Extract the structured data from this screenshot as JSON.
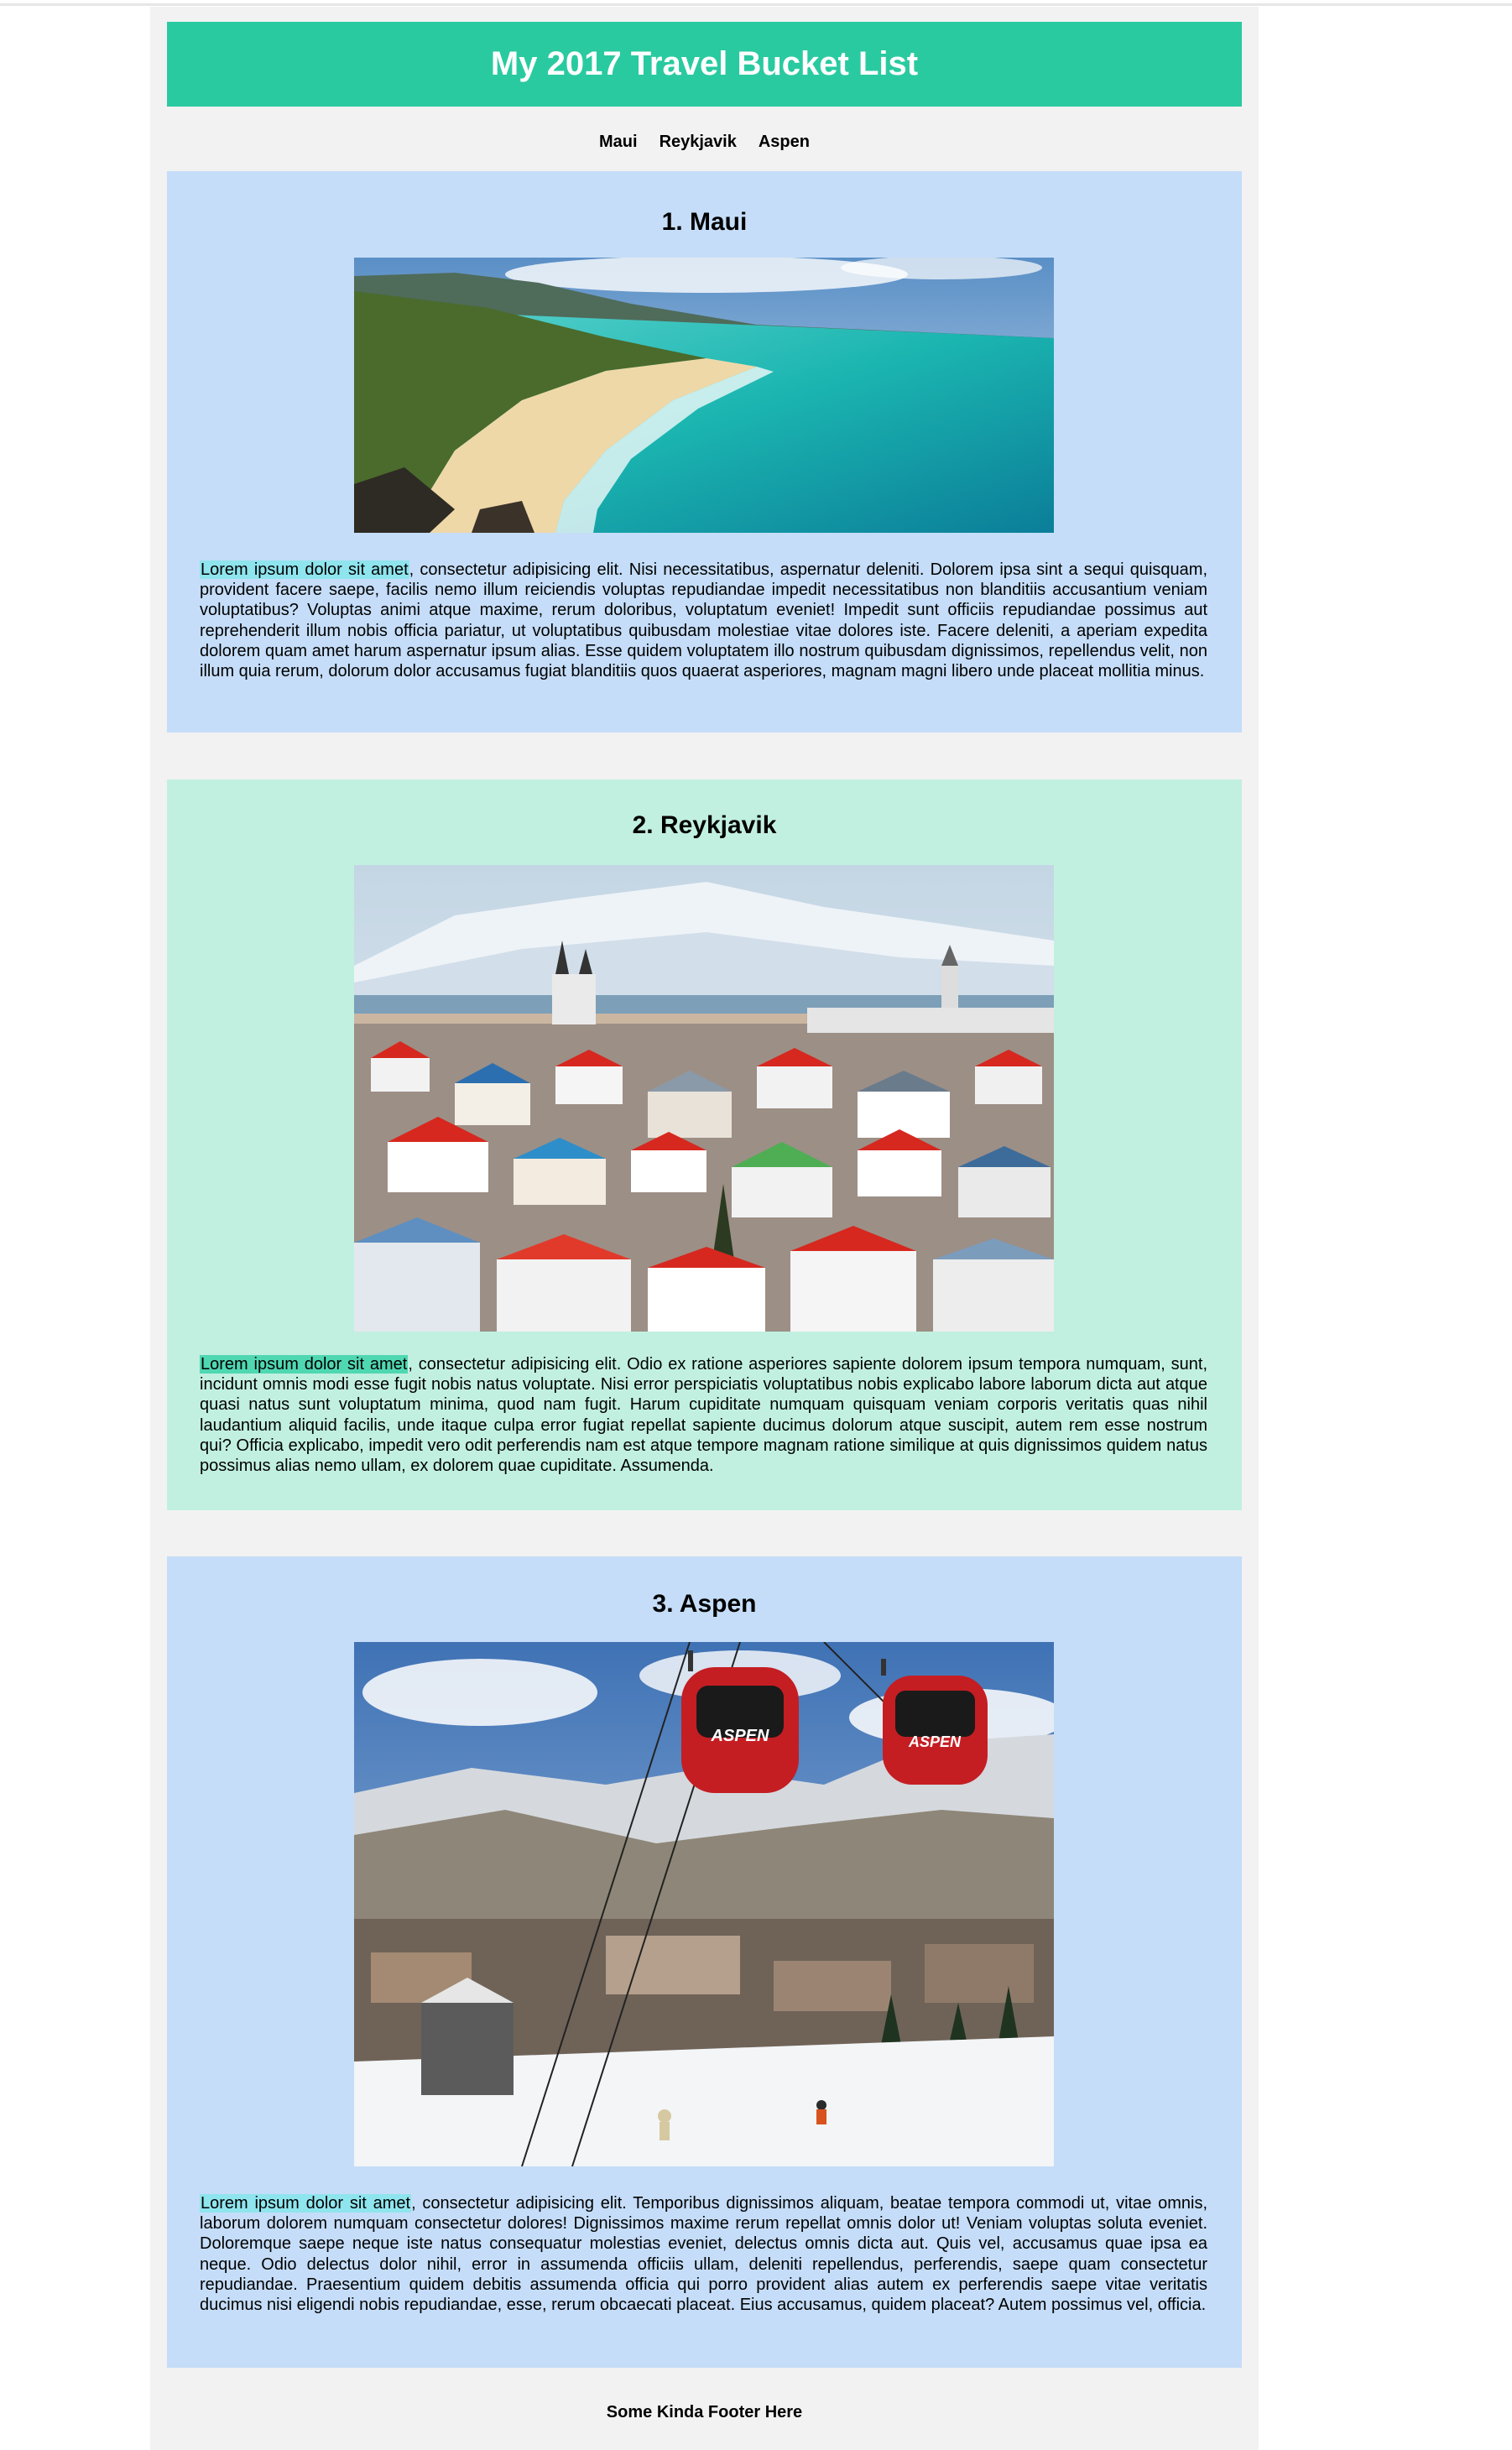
{
  "header": {
    "title": "My 2017 Travel Bucket List"
  },
  "nav": {
    "items": [
      "Maui",
      "Reykjavik",
      "Aspen"
    ]
  },
  "colors": {
    "header": "#2acaa0",
    "card_blue": "#c5ddf8",
    "card_mint": "#c2f0e0",
    "highlight_cyan": "#8fe5ee",
    "highlight_green": "#4fd7b2"
  },
  "sections": [
    {
      "heading": "1. Maui",
      "image": "beach-photo",
      "highlight": "Lorem ipsum dolor sit amet",
      "body": ", consectetur adipisicing elit. Nisi necessitatibus, aspernatur deleniti. Dolorem ipsa sint a sequi quisquam, provident facere saepe, facilis nemo illum reiciendis voluptas repudiandae impedit necessitatibus non blanditiis accusantium veniam voluptatibus? Voluptas animi atque maxime, rerum doloribus, voluptatum eveniet! Impedit sunt officiis repudiandae possimus aut reprehenderit illum nobis officia pariatur, ut voluptatibus quibusdam molestiae vitae dolores iste. Facere deleniti, a aperiam expedita dolorem quam amet harum aspernatur ipsum alias. Esse quidem voluptatem illo nostrum quibusdam dignissimos, repellendus velit, non illum quia rerum, dolorum dolor accusamus fugiat blanditiis quos quaerat asperiores, magnam magni libero unde placeat mollitia minus."
    },
    {
      "heading": "2. Reykjavik",
      "image": "city-photo",
      "highlight": "Lorem ipsum dolor sit amet",
      "body": ", consectetur adipisicing elit. Odio ex ratione asperiores sapiente dolorem ipsum tempora numquam, sunt, incidunt omnis modi esse fugit nobis natus voluptate. Nisi error perspiciatis voluptatibus nobis explicabo labore laborum dicta aut atque quasi natus sunt voluptatum minima, quod nam fugit. Harum cupiditate numquam quisquam veniam corporis veritatis quas nihil laudantium aliquid facilis, unde itaque culpa error fugiat repellat sapiente ducimus dolorum atque suscipit, autem rem esse nostrum qui? Officia explicabo, impedit vero odit perferendis nam est atque tempore magnam ratione similique at quis dignissimos quidem natus possimus alias nemo ullam, ex dolorem quae cupiditate. Assumenda."
    },
    {
      "heading": "3. Aspen",
      "image": "ski-photo",
      "image_text": "ASPEN",
      "highlight": "Lorem ipsum dolor sit amet",
      "body": ", consectetur adipisicing elit. Temporibus dignissimos aliquam, beatae tempora commodi ut, vitae omnis, laborum dolorem numquam consectetur dolores! Dignissimos maxime rerum repellat omnis dolor ut! Veniam voluptas soluta eveniet. Doloremque saepe neque iste natus consequatur molestias eveniet, delectus omnis dicta aut. Quis vel, accusamus quae ipsa ea neque. Odio delectus dolor nihil, error in assumenda officiis ullam, deleniti repellendus, perferendis, saepe quam consectetur repudiandae. Praesentium quidem debitis assumenda officia qui porro provident alias autem ex perferendis saepe vitae veritatis ducimus nisi eligendi nobis repudiandae, esse, rerum obcaecati placeat. Eius accusamus, quidem placeat? Autem possimus vel, officia."
    }
  ],
  "footer": {
    "text": "Some Kinda Footer Here"
  }
}
